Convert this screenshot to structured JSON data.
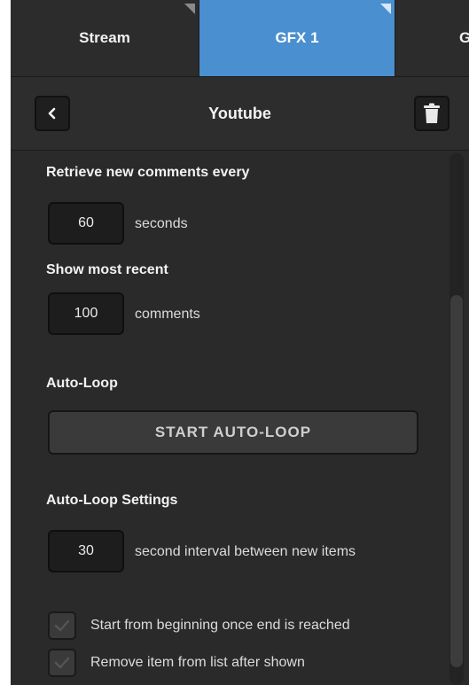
{
  "tabs": [
    {
      "label": "Stream",
      "active": false
    },
    {
      "label": "GFX 1",
      "active": true
    },
    {
      "label": "GF",
      "active": false
    }
  ],
  "header": {
    "title": "Youtube",
    "back_icon": "chevron-left-icon",
    "delete_icon": "trash-icon"
  },
  "retrieve": {
    "label": "Retrieve new comments every",
    "value": "60",
    "unit": "seconds"
  },
  "recent": {
    "label": "Show most recent",
    "value": "100",
    "unit": "comments"
  },
  "autoloop": {
    "label": "Auto-Loop",
    "button_label": "START AUTO-LOOP"
  },
  "autoloop_settings": {
    "label": "Auto-Loop Settings",
    "interval_value": "30",
    "interval_unit": "second interval between new items",
    "options": [
      {
        "label": "Start from beginning once end is reached",
        "checked": true
      },
      {
        "label": "Remove item from list after shown",
        "checked": true
      }
    ]
  },
  "colors": {
    "accent": "#4a8fd0",
    "panel": "#2a2a2a",
    "field": "#1d1d1d"
  }
}
